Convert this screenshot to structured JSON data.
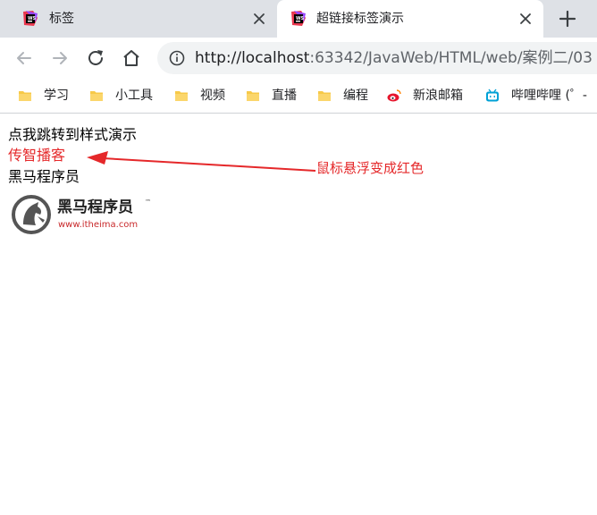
{
  "tabs": [
    {
      "title": "标签",
      "active": false
    },
    {
      "title": "超链接标签演示",
      "active": true
    }
  ],
  "new_tab_label": "+",
  "address_bar": {
    "url_host": "http://localhost",
    "url_rest": ":63342/JavaWeb/HTML/web/案例二/03"
  },
  "bookmarks": [
    {
      "label": "学习",
      "icon": "folder-icon"
    },
    {
      "label": "小工具",
      "icon": "folder-icon"
    },
    {
      "label": "视频",
      "icon": "folder-icon"
    },
    {
      "label": "直播",
      "icon": "folder-icon"
    },
    {
      "label": "编程",
      "icon": "folder-icon"
    },
    {
      "label": "新浪邮箱",
      "icon": "weibo-icon"
    },
    {
      "label": "哔哩哔哩 (゜-",
      "icon": "bilibili-icon"
    }
  ],
  "page": {
    "link1": "点我跳转到样式演示",
    "link2": "传智播客",
    "link3": "黑马程序员",
    "logo_name": "黑马程序员",
    "logo_tm": "™",
    "logo_url": "www.itheima.com",
    "annotation": "鼠标悬浮变成红色"
  },
  "colors": {
    "tab_strip": "#dee1e6",
    "hover_red": "#e5282a",
    "folder": "#f7c948"
  }
}
